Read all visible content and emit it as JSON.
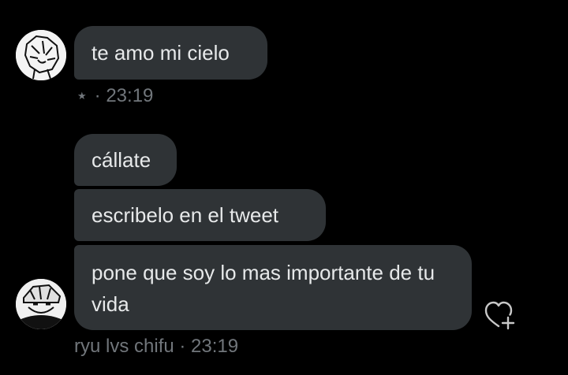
{
  "theme": {
    "background": "#000000",
    "bubble": "#2f3336",
    "text": "#e7e9ea",
    "muted": "#71767b"
  },
  "conversation": {
    "group_one": {
      "messages": [
        {
          "text": "te amo mi cielo"
        }
      ],
      "meta": {
        "icon": "star-icon",
        "separator": "·",
        "time": "23:19"
      }
    },
    "group_two": {
      "messages": [
        {
          "text": "cállate"
        },
        {
          "text": "escribelo en el tweet"
        },
        {
          "text": "pone que soy lo mas importante de tu vida"
        }
      ],
      "meta": {
        "sender": "ryu lvs chifu",
        "separator": "·",
        "time": "23:19"
      },
      "reaction_icon": "heart-add-icon"
    }
  }
}
